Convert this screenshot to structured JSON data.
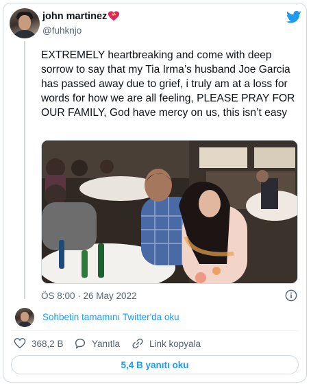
{
  "author": {
    "display_name": "john martinez",
    "handle": "@fuhknjo",
    "badge_icon": "heart-emoji-icon"
  },
  "tweet": {
    "text": "EXTREMELY heartbreaking and come with deep sorrow to say that my Tia Irma’s husband Joe Garcia has passed away due to grief, i truly am at a loss for words for how we are all feeling, PLEASE PRAY FOR OUR FAMILY, God have mercy on us, this isn’t easy",
    "timestamp": "ÖS 8:00 · 26 May 2022"
  },
  "thread": {
    "link_text": "Sohbetin tamamını Twitter'da oku"
  },
  "actions": {
    "likes": "368,2 B",
    "reply_label": "Yanıtla",
    "copy_link_label": "Link kopyala"
  },
  "footer": {
    "read_replies_label": "5,4 B yanıtı oku"
  },
  "colors": {
    "link_blue": "#1d9bf0",
    "like_red": "#f91880",
    "muted_text": "#536471",
    "border": "#cfd9de"
  }
}
